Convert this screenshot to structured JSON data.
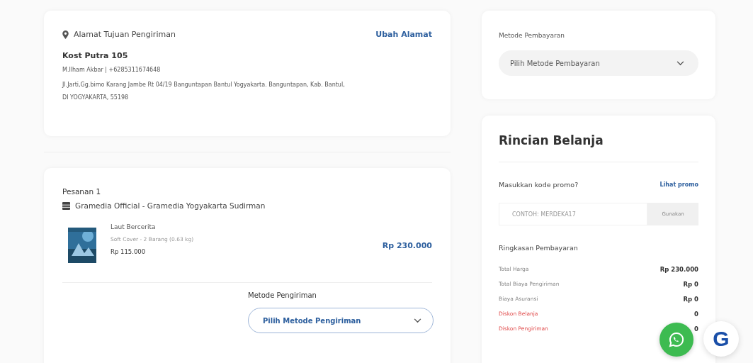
{
  "address": {
    "title": "Alamat Tujuan Pengiriman",
    "change_link": "Ubah Alamat",
    "name": "Kost Putra 105",
    "contact": "M.Ilham Akbar | +6285311674648",
    "street": "Jl.Jarti,Gg.bimo Karang Jambe Rt 04/19 Banguntapan Bantul Yogyakarta. Banguntapan, Kab. Bantul,",
    "region": "DI YOGYAKARTA, 55198"
  },
  "order": {
    "title": "Pesanan 1",
    "store": "Gramedia Official - Gramedia Yogyakarta Sudirman",
    "product": {
      "name": "Laut Bercerita",
      "detail": "Soft Cover - 2 Barang (0.63 kg)",
      "unit_price": "Rp 115.000",
      "total": "Rp 230.000"
    },
    "shipping_label": "Metode Pengiriman",
    "shipping_select": "Pilih Metode Pengiriman"
  },
  "payment": {
    "label": "Metode Pembayaran",
    "select": "Pilih Metode Pembayaran"
  },
  "summary": {
    "title": "Rincian Belanja",
    "promo_label": "Masukkan kode promo?",
    "promo_link": "Lihat promo",
    "promo_placeholder": "CONTOH: MERDEKA17",
    "promo_button": "Gunakan",
    "breakdown_title": "Ringkasan Pembayaran",
    "rows": [
      {
        "label": "Total Harga",
        "value": "Rp 230.000",
        "kind": "normal"
      },
      {
        "label": "Total Biaya Pengiriman",
        "value": "Rp 0",
        "kind": "normal"
      },
      {
        "label": "Biaya Asuransi",
        "value": "Rp 0",
        "kind": "normal"
      },
      {
        "label": "Diskon Belanja",
        "value": "0",
        "kind": "discount"
      },
      {
        "label": "Diskon Pengiriman",
        "value": "0",
        "kind": "discount"
      }
    ]
  },
  "floating": {
    "logo": "G"
  }
}
